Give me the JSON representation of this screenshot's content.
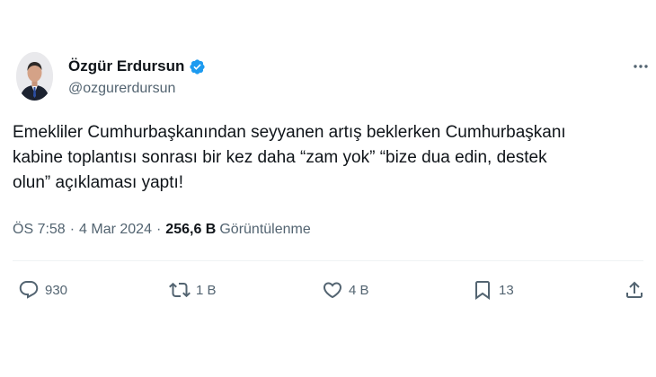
{
  "author": {
    "display_name": "Özgür Erdursun",
    "handle": "@ozgurerdursun",
    "verified": true,
    "verified_color": "#1d9bf0"
  },
  "tweet": {
    "text": "Emekliler Cumhurbaşkanından seyyanen artış beklerken Cumhurbaşkanı\nkabine toplantısı sonrası bir kez daha “zam yok” “bize dua edin, destek\nolun” açıklaması yaptı!",
    "time": "ÖS 7:58",
    "date": "4 Mar 2024",
    "separator": "·",
    "views_count": "256,6 B",
    "views_label": "Görüntülenme"
  },
  "actions": {
    "reply_count": "930",
    "retweet_count": "1 B",
    "like_count": "4 B",
    "bookmark_count": "13"
  },
  "icons": {
    "more": "more-dots-icon",
    "reply": "reply-icon",
    "retweet": "retweet-icon",
    "like": "heart-icon",
    "bookmark": "bookmark-icon",
    "share": "share-icon",
    "verified": "verified-badge-icon"
  },
  "colors": {
    "text_primary": "#0f1419",
    "text_secondary": "#536471",
    "divider": "#eff3f4"
  }
}
